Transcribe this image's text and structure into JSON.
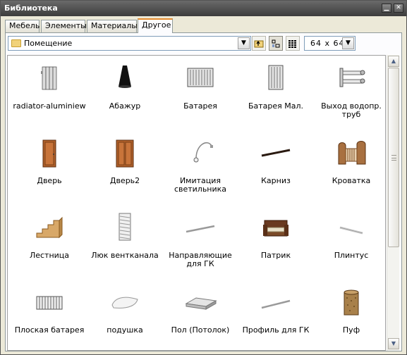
{
  "window": {
    "title": "Библиотека"
  },
  "tabs": [
    {
      "label": "Мебель"
    },
    {
      "label": "Элементы"
    },
    {
      "label": "Материалы"
    },
    {
      "label": "Другое"
    }
  ],
  "toolbar": {
    "category": "Помещение",
    "icon_size": "64 x  64"
  },
  "items": [
    {
      "label": "radiator-aluminiew",
      "icon": "radiator-icon"
    },
    {
      "label": "Абажур",
      "icon": "lampshade-icon"
    },
    {
      "label": "Батарея",
      "icon": "radiator-icon"
    },
    {
      "label": "Батарея Мал.",
      "icon": "radiator-icon"
    },
    {
      "label": "Выход водопр. труб",
      "icon": "pipes-icon"
    },
    {
      "label": "Дверь",
      "icon": "door-icon"
    },
    {
      "label": "Дверь2",
      "icon": "double-door-icon"
    },
    {
      "label": "Имитация светильника",
      "icon": "lamp-icon"
    },
    {
      "label": "Карниз",
      "icon": "cornice-icon"
    },
    {
      "label": "Кроватка",
      "icon": "crib-icon"
    },
    {
      "label": "Лестница",
      "icon": "stairs-icon"
    },
    {
      "label": "Люк вентканала",
      "icon": "vent-grille-icon"
    },
    {
      "label": "Направляющие для ГК",
      "icon": "rail-icon"
    },
    {
      "label": "Патрик",
      "icon": "armchair-icon"
    },
    {
      "label": "Плинтус",
      "icon": "baseboard-icon"
    },
    {
      "label": "Плоская батарея",
      "icon": "flat-radiator-icon"
    },
    {
      "label": "подушка",
      "icon": "pillow-icon"
    },
    {
      "label": "Пол (Потолок)",
      "icon": "floor-slab-icon"
    },
    {
      "label": "Профиль для ГК",
      "icon": "profile-icon"
    },
    {
      "label": "Пуф",
      "icon": "pouf-icon"
    }
  ]
}
